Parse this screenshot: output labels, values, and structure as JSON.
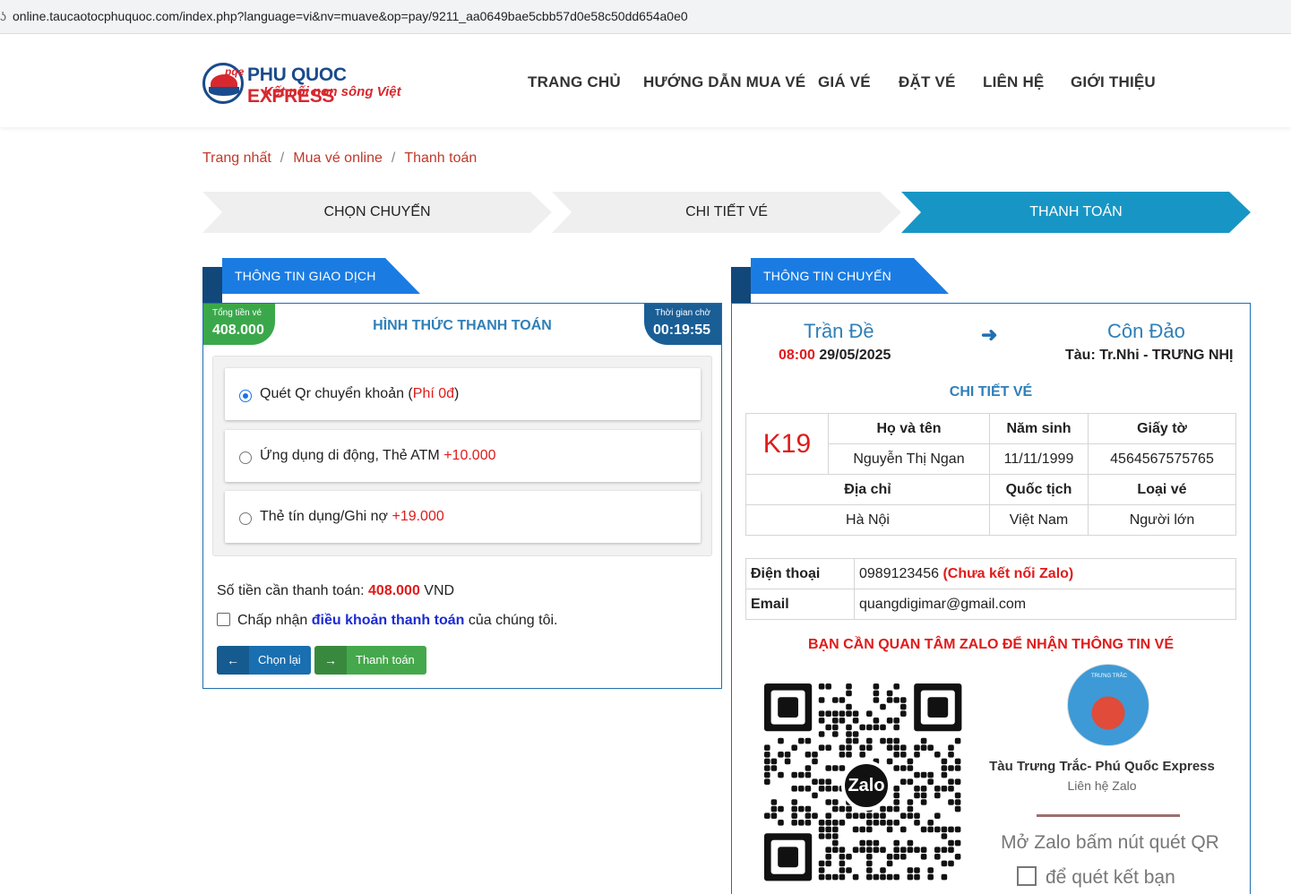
{
  "browser": {
    "url": "online.taucaotocphuquoc.com/index.php?language=vi&nv=muave&op=pay/9211_aa0649bae5cbb57d0e58c50dd654a0e0"
  },
  "logo": {
    "name_a": "PHU QUOC ",
    "name_b": "EXPRESS",
    "slogan": "Kết nối non sông Việt",
    "mark": "pqe"
  },
  "nav": [
    "TRANG CHỦ",
    "HƯỚNG DẪN MUA VÉ",
    "GIÁ VÉ",
    "ĐẶT VÉ",
    "LIÊN HỆ",
    "GIỚI THIỆU"
  ],
  "breadcrumb": [
    "Trang nhất",
    "Mua vé online",
    "Thanh toán"
  ],
  "steps": [
    {
      "label": "CHỌN CHUYẾN",
      "active": false
    },
    {
      "label": "CHI TIẾT VÉ",
      "active": false
    },
    {
      "label": "THANH TOÁN",
      "active": true
    }
  ],
  "transaction": {
    "ribbon": "THÔNG TIN GIAO DỊCH",
    "total_label": "Tổng tiền vé",
    "total_value": "408.000",
    "timer_label": "Thời gian chờ",
    "timer_value": "00:19:55",
    "method_title": "HÌNH THỨC THANH TOÁN",
    "options": [
      {
        "label": "Quét Qr chuyển khoản (",
        "fee": "Phí 0đ",
        "suffix": ")",
        "selected": true
      },
      {
        "label": "Ứng dụng di động, Thẻ ATM ",
        "fee": "+10.000",
        "suffix": "",
        "selected": false
      },
      {
        "label": "Thẻ tín dụng/Ghi nợ ",
        "fee": "+19.000",
        "suffix": "",
        "selected": false
      }
    ],
    "amount_label": "Số tiền cần thanh toán: ",
    "amount_value": "408.000",
    "amount_unit": " VND",
    "agree_prefix": "Chấp nhận ",
    "agree_link": "điều khoản thanh toán",
    "agree_suffix": " của chúng tôi.",
    "btn_back": "Chọn lại",
    "btn_pay": "Thanh toán"
  },
  "trip": {
    "ribbon": "THÔNG TIN CHUYẾN",
    "from": "Trần Đề",
    "to": "Côn Đảo",
    "time": "08:00",
    "date": " 29/05/2025",
    "ship": "Tàu: Tr.Nhi - TRƯNG NHỊ",
    "details_title": "CHI TIẾT VÉ",
    "seat": "K19",
    "headers": {
      "name": "Họ và tên",
      "birth": "Năm sinh",
      "doc": "Giấy tờ",
      "address": "Địa chỉ",
      "nation": "Quốc tịch",
      "type": "Loại vé"
    },
    "passenger": {
      "name": "Nguyễn Thị Ngan",
      "birth": "11/11/1999",
      "doc": "4564567575765",
      "address": "Hà Nội",
      "nation": "Việt Nam",
      "type": "Người lớn"
    },
    "phone_label": "Điện thoại",
    "phone": "0989123456 ",
    "phone_note": "(Chưa kết nối Zalo)",
    "email_label": "Email",
    "email": "quangdigimar@gmail.com",
    "zalo_warning": "BẠN CẦN QUAN TÂM ZALO ĐỂ NHẬN THÔNG TIN VÉ",
    "zalo_logo": "Zalo",
    "zalo_avatar_caption": "TRƯNG TRẮC",
    "zalo_name": "Tàu Trưng Trắc- Phú Quốc Express",
    "zalo_sub": "Liên hệ Zalo",
    "zalo_hint1": "Mở Zalo bấm nút quét QR",
    "zalo_hint2": "để quét kết bạn"
  }
}
